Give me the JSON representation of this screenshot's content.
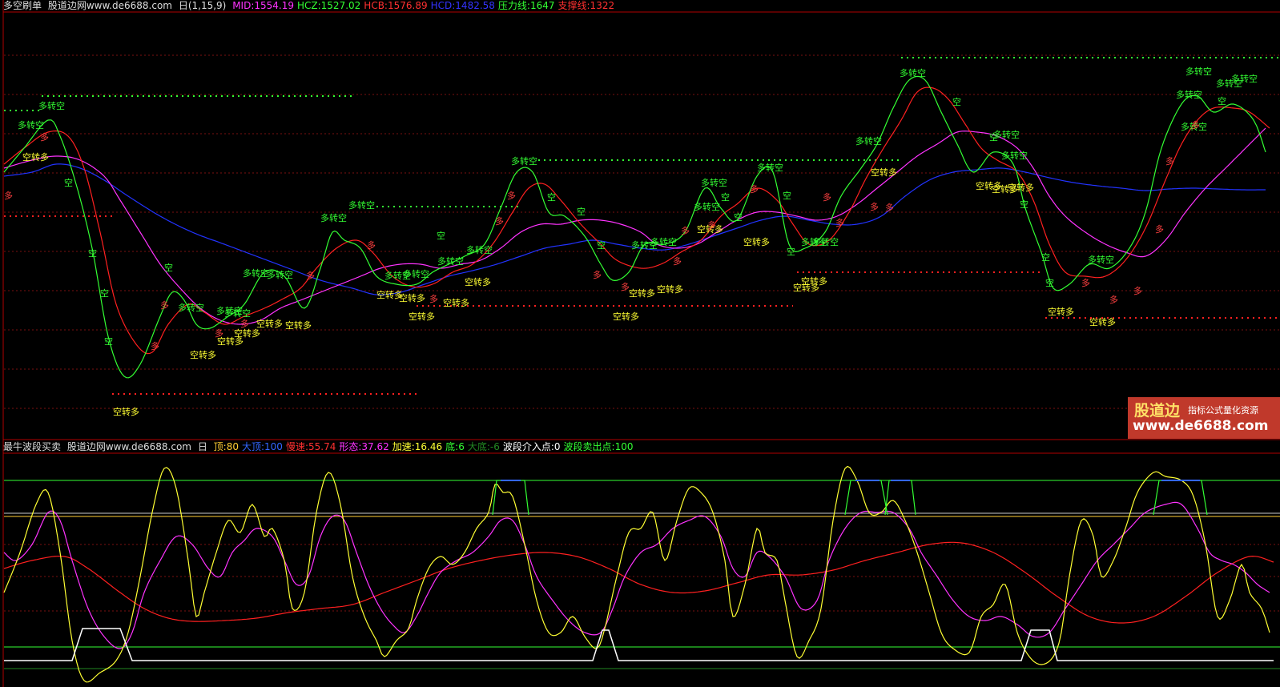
{
  "top_panel": {
    "title": "多空刷单",
    "source": "股道边网www.de6688.com",
    "period": "日(1,15,9)",
    "readouts": [
      {
        "label": "MID:1554.19",
        "color": "#ff33ff"
      },
      {
        "label": "HCZ:1527.02",
        "color": "#33ff33"
      },
      {
        "label": "HCB:1576.89",
        "color": "#ff3030"
      },
      {
        "label": "HCD:1482.58",
        "color": "#3333ff"
      },
      {
        "label": "压力线:1647",
        "color": "#33ff33"
      },
      {
        "label": "支撑线:1322",
        "color": "#ff3030"
      }
    ],
    "signals": {
      "buy_label": "空转多",
      "sell_label": "多转空",
      "long_mark": "多",
      "short_mark": "空"
    }
  },
  "bottom_panel": {
    "title": "最牛波段买卖",
    "source": "股道边网www.de6688.com",
    "period": "日",
    "readouts": [
      {
        "label": "顶:80",
        "color": "#ffcc33"
      },
      {
        "label": "大顶:100",
        "color": "#3366ff"
      },
      {
        "label": "慢速:55.74",
        "color": "#ff3030"
      },
      {
        "label": "形态:37.62",
        "color": "#ff33ff"
      },
      {
        "label": "加速:16.46",
        "color": "#ffff33"
      },
      {
        "label": "底:6",
        "color": "#33ff33"
      },
      {
        "label": "大底:-6",
        "color": "#228822"
      },
      {
        "label": "波段介入点:0",
        "color": "#ffffff"
      },
      {
        "label": "波段卖出点:100",
        "color": "#33ff33"
      }
    ]
  },
  "watermark": {
    "brand": "股道边",
    "tagline": "指标公式量化资源",
    "url": "www.de6688.com"
  },
  "colors": {
    "background": "#000000",
    "grid": "#7a1010",
    "fast_line": "#33ff33",
    "mid_line": "#ff2020",
    "slow_line": "#ff33ff",
    "long_line": "#2233ff",
    "speed_line": "#ffff33",
    "band_line": "#ffffff"
  }
}
